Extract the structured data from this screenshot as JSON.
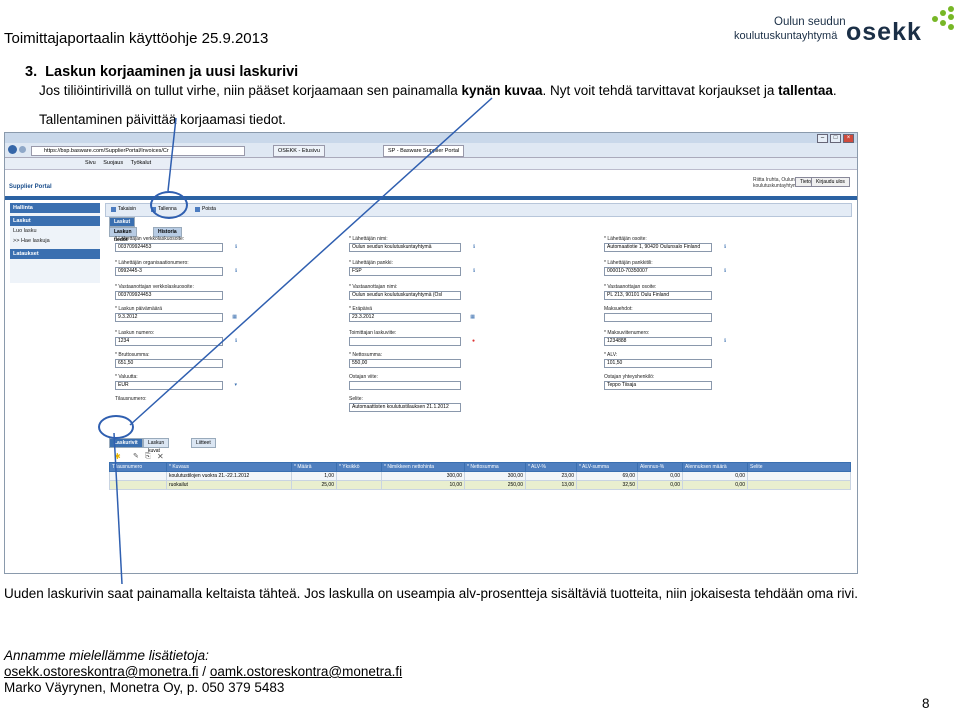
{
  "doc_header": {
    "title": "Toimittajaportaalin käyttöohje 25.9.2013",
    "logo_line1": "Oulun seudun",
    "logo_line2": "koulutuskuntayhtymä",
    "logo_brand": "osekk",
    "logo_color": "#77b726"
  },
  "section": {
    "number": "3.",
    "title": "Laskun korjaaminen ja uusi laskurivi",
    "p1_line1_start": "Jos tiliöintirivillä on tullut virhe, niin pääset korjaamaan sen painamalla ",
    "p1_line1_bold": "kynän kuvaa",
    "p1_line1_end": ". Nyt voit tehdä tarvittavat korjaukset ja ",
    "p1_line1_bold2": "tallentaa",
    "p1_line1_end2": ".",
    "p2": "Tallentaminen päivittää korjaamasi tiedot."
  },
  "browser": {
    "url": "https://bsp.basware.com/SupplierPortal/Invoices/Cr",
    "tab1": "OSEKK - Etusivu",
    "tab2": "SP - Basware Supplier Portal",
    "cmd_items": [
      "Sivu",
      "Suojaus",
      "Työkalut"
    ],
    "user_text": "Riitta Iruhta, Oulun seudun koulutuskuntayhtymä",
    "btn_info": "Tietoja",
    "btn_logout": "Kirjaudu ulos",
    "portal_title": "Supplier Portal",
    "sidebar": {
      "h1": "Hallinta",
      "h2": "Laskut",
      "i1": "Luo lasku",
      "i2": ">> Hae laskuja",
      "h3": "Lataukset"
    },
    "toolbar": {
      "back": "Takaisin",
      "save": "Tallenna",
      "delete": "Poista"
    },
    "tabs": {
      "main": "Laskut tiedot",
      "info": "Laskun tiedot",
      "history": "Historia"
    },
    "fields": [
      {
        "label": "* Lähettäjän verkkolaskuosoite:",
        "value": "003709924453"
      },
      {
        "label": "* Lähettäjän organisaationumero:",
        "value": "0992445-3"
      },
      {
        "label": "* Vastaanottajan verkkolaskuosoite:",
        "value": "003709924453"
      },
      {
        "label": "* Laskun päivämäärä",
        "value": "9.3.2012"
      },
      {
        "label": "* Laskun numero:",
        "value": "1234"
      },
      {
        "label": "* Bruttosumma:",
        "value": "651,50"
      },
      {
        "label": "* Valuutta:",
        "value": "EUR"
      },
      {
        "label": "Tilausnumero:",
        "value": ""
      },
      {
        "label": "* Lähettäjän nimi:",
        "value": "Oulun seudun koulutuskuntayhtymä"
      },
      {
        "label": "* Lähettäjän pankki:",
        "value": "FSP"
      },
      {
        "label": "* Vastaanottajan nimi:",
        "value": "Oulun seudun koulutuskuntayhtymä (Osl"
      },
      {
        "label": "* Eräpäivä",
        "value": "23.3.2012"
      },
      {
        "label": "Toimittajan laskuviite:",
        "value": ""
      },
      {
        "label": "* Nettosumma:",
        "value": "550,00"
      },
      {
        "label": "Ostajan viite:",
        "value": ""
      },
      {
        "label": "Selite:",
        "value": "Automaattisten koulutustilauksen 21.1.2012"
      },
      {
        "label": "* Lähettäjän osoite:",
        "value": "Automaatiotie 1, 90420 Oulunsalo Finland"
      },
      {
        "label": "* Lähettäjän pankkitili:",
        "value": "000010-70350007"
      },
      {
        "label": "* Vastaanottajan osoite:",
        "value": "PL 213, 90101 Oulu Finland"
      },
      {
        "label": "Maksuehdot:",
        "value": ""
      },
      {
        "label": "* Maksuviitenumero:",
        "value": "1234888"
      },
      {
        "label": "* ALV:",
        "value": "101,50"
      },
      {
        "label": "Ostajan yhteyshenkilö:",
        "value": "Teppo Tiisaja"
      }
    ],
    "row_tabs": {
      "rows": "Laskurivit",
      "files": "Laskun kuvat",
      "attach": "Liitteet"
    },
    "grid": {
      "headers": [
        "Tilausnumero",
        "* Kuvaus",
        "* Määrä",
        "* Yksikkö",
        "* Nimikkeen nettohinta",
        "* Nettosumma",
        "* ALV-%",
        "* ALV-summa",
        "Alennus-%",
        "Alennuksen määrä",
        "Selite"
      ],
      "rows": [
        [
          "",
          "koulutustilojen vuokra 21.-22.1.2012",
          "1,00",
          "",
          "300,00",
          "300,00",
          "23,00",
          "69,00",
          "0,00",
          "0,00",
          ""
        ],
        [
          "",
          "ruokailut",
          "25,00",
          "",
          "10,00",
          "250,00",
          "13,00",
          "32,50",
          "0,00",
          "0,00",
          ""
        ]
      ]
    }
  },
  "bottom": {
    "instruction": "Uuden laskurivin saat painamalla keltaista tähteä. Jos laskulla on useampia alv-prosentteja sisältäviä tuotteita, niin jokaisesta tehdään oma rivi.",
    "more_info": "Annamme mielellämme lisätietoja:",
    "email1": "osekk.ostoreskontra@monetra.fi",
    "sep": " / ",
    "email2": "oamk.ostoreskontra@monetra.fi",
    "signature": "Marko Väyrynen, Monetra Oy, p. 050 379 5483",
    "page_number": "8"
  }
}
